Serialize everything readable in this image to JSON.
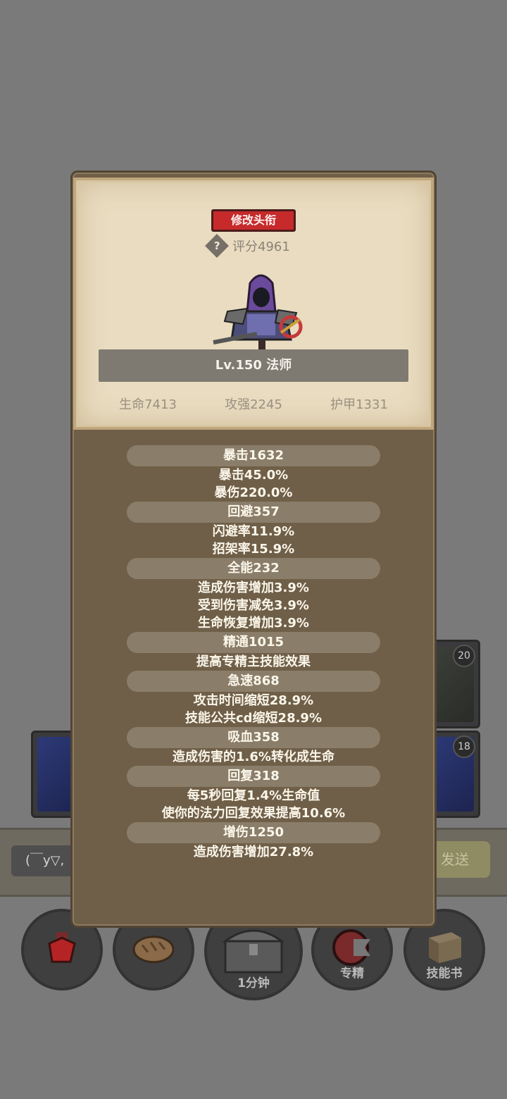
{
  "background": {
    "slots": [
      {
        "badge": "20"
      },
      {
        "badge": "18"
      }
    ],
    "chat": {
      "input_text": "(￣y▽,",
      "send_label": "发送"
    },
    "bottom_buttons": [
      {
        "icon": "potion-icon",
        "label": ""
      },
      {
        "icon": "bread-icon",
        "label": ""
      },
      {
        "icon": "treasure-chest-icon",
        "label": "1分钟"
      },
      {
        "icon": "specialization-icon",
        "label": "专精"
      },
      {
        "icon": "skill-book-icon",
        "label": "技能书"
      }
    ]
  },
  "profile": {
    "title_button": "修改头衔",
    "help_icon": "?",
    "rating": "评分4961",
    "level_class": "Lv.150 法师",
    "base_stats": [
      "生命7413",
      "攻强2245",
      "护甲1331"
    ]
  },
  "stats": [
    {
      "header": "暴击1632",
      "lines": [
        "暴击45.0%",
        "暴伤220.0%"
      ]
    },
    {
      "header": "回避357",
      "lines": [
        "闪避率11.9%",
        "招架率15.9%"
      ]
    },
    {
      "header": "全能232",
      "lines": [
        "造成伤害增加3.9%",
        "受到伤害减免3.9%",
        "生命恢复增加3.9%"
      ]
    },
    {
      "header": "精通1015",
      "lines": [
        "提高专精主技能效果"
      ]
    },
    {
      "header": "急速868",
      "lines": [
        "攻击时间缩短28.9%",
        "技能公共cd缩短28.9%"
      ]
    },
    {
      "header": "吸血358",
      "lines": [
        "造成伤害的1.6%转化成生命"
      ]
    },
    {
      "header": "回复318",
      "lines": [
        "每5秒回复1.4%生命值",
        "使你的法力回复效果提高10.6%"
      ]
    },
    {
      "header": "增伤1250",
      "lines": [
        "造成伤害增加27.8%"
      ]
    }
  ]
}
